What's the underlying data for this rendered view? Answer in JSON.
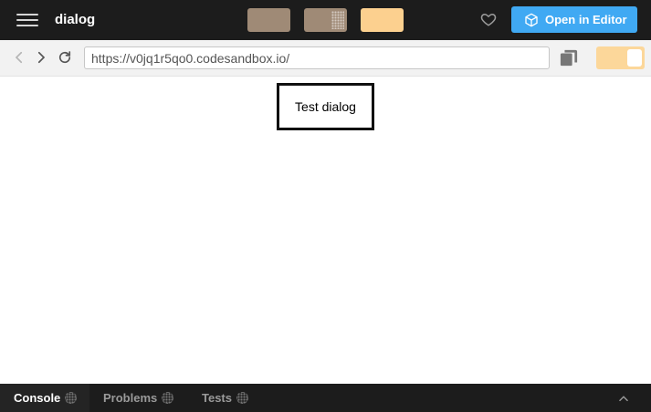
{
  "header": {
    "menu_icon": "hamburger-menu-icon",
    "title": "dialog",
    "swatches": [
      {
        "color": "#9f8a76"
      },
      {
        "color": "#9f8a76",
        "pattern": "dotted"
      },
      {
        "color": "#fcd08f"
      }
    ],
    "like_icon": "heart-icon",
    "open_button": {
      "label": "Open in Editor",
      "icon": "cube-icon",
      "color": "#40a9f3"
    }
  },
  "browser": {
    "back_icon": "chevron-left-icon",
    "forward_icon": "chevron-right-icon",
    "refresh_icon": "refresh-icon",
    "url": "https://v0jq1r5qo0.codesandbox.io/",
    "copy_icon": "copy-icon",
    "toggle_color": "#fcd79a"
  },
  "preview": {
    "dialog_text": "Test dialog"
  },
  "console": {
    "tabs": [
      {
        "label": "Console",
        "active": true
      },
      {
        "label": "Problems",
        "active": false
      },
      {
        "label": "Tests",
        "active": false
      }
    ],
    "collapse_icon": "chevron-up-icon"
  }
}
